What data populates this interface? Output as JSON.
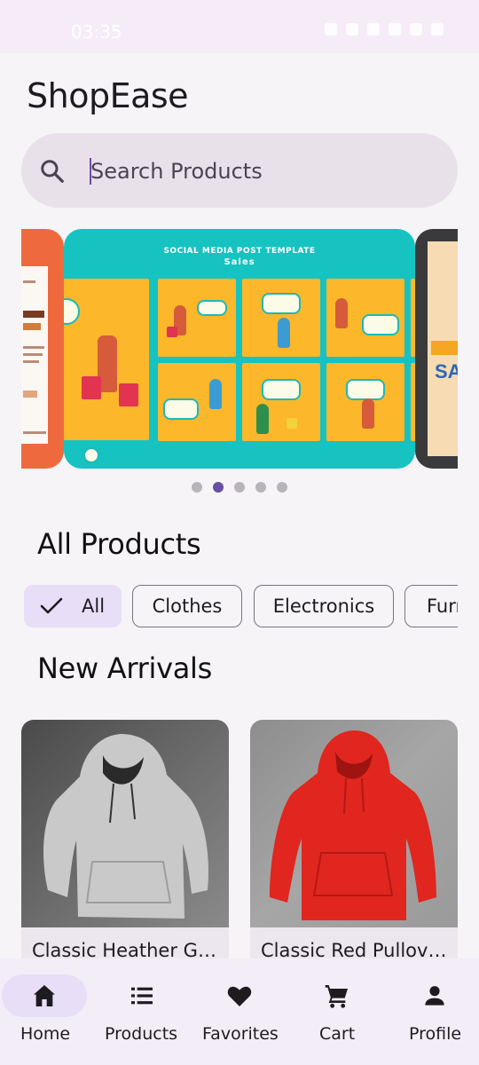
{
  "status_bar": {
    "time": "03:35"
  },
  "app": {
    "title": "ShopEase"
  },
  "search": {
    "placeholder": "Search Products"
  },
  "carousel": {
    "main_banner_header": "SOCIAL MEDIA POST TEMPLATE",
    "main_banner_subheader": "Sales",
    "right_banner_text": "SA",
    "page_count": 5,
    "active_page": 2
  },
  "all_products": {
    "title": "All Products",
    "chips": [
      {
        "label": "All",
        "selected": true
      },
      {
        "label": "Clothes",
        "selected": false
      },
      {
        "label": "Electronics",
        "selected": false
      },
      {
        "label": "Furniture",
        "selected": false
      }
    ]
  },
  "new_arrivals": {
    "title": "New Arrivals",
    "products": [
      {
        "name": "Classic Heather Gray Hoodie",
        "color": "#c9c9c9"
      },
      {
        "name": "Classic Red Pullover Hoodie",
        "color": "#e0261f"
      }
    ]
  },
  "bottom_nav": {
    "items": [
      {
        "label": "Home",
        "icon": "home-icon",
        "active": true
      },
      {
        "label": "Products",
        "icon": "list-icon",
        "active": false
      },
      {
        "label": "Favorites",
        "icon": "heart-icon",
        "active": false
      },
      {
        "label": "Cart",
        "icon": "cart-icon",
        "active": false
      },
      {
        "label": "Profile",
        "icon": "person-icon",
        "active": false
      }
    ]
  },
  "colors": {
    "accent": "#6750a4",
    "chip_selected": "#e8def8",
    "nav_background": "#f3edf7",
    "search_background": "#e8e1e9",
    "banner_teal": "#16c3c0",
    "banner_orange": "#ee6a3e"
  }
}
